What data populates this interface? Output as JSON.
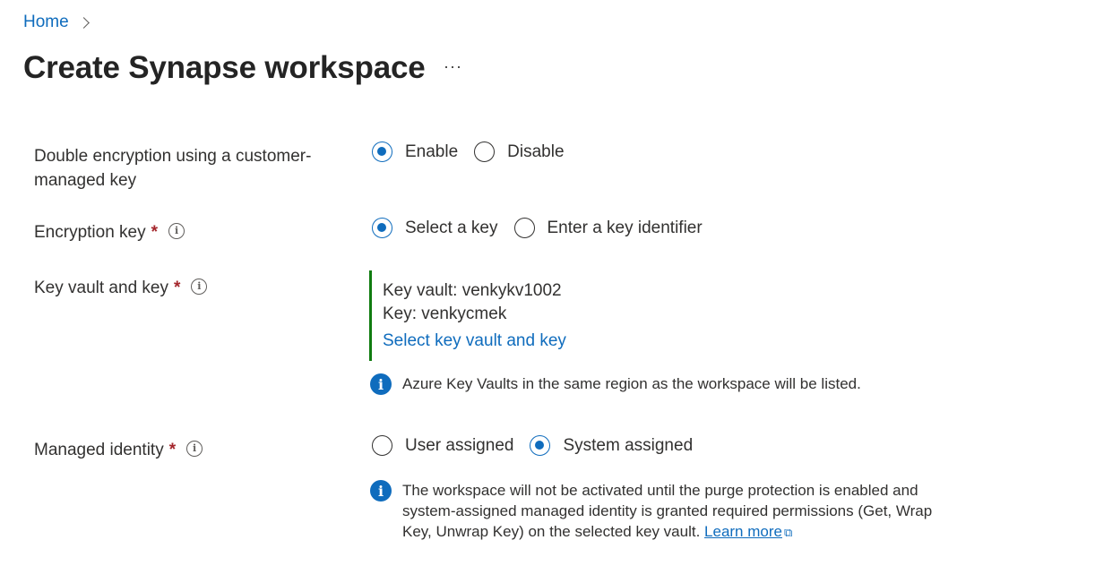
{
  "breadcrumb": {
    "home": "Home"
  },
  "page": {
    "title": "Create Synapse workspace",
    "more": "···"
  },
  "double_encryption": {
    "label_line1": "Double encryption using a customer-",
    "label_line2": "managed key",
    "options": [
      "Enable",
      "Disable"
    ],
    "selected": "Enable"
  },
  "encryption_key": {
    "label": "Encryption key",
    "required": "*",
    "options": [
      "Select a key",
      "Enter a key identifier"
    ],
    "selected": "Select a key"
  },
  "key_vault": {
    "label": "Key vault and key",
    "required": "*",
    "vault_line": "Key vault: venkykv1002",
    "key_line": "Key: venkycmek",
    "select_link": "Select key vault and key",
    "note": "Azure Key Vaults in the same region as the workspace will be listed."
  },
  "managed_identity": {
    "label": "Managed identity",
    "required": "*",
    "options": [
      "User assigned",
      "System assigned"
    ],
    "selected": "System assigned",
    "note_line1": "The workspace will not be activated until the purge protection is enabled and",
    "note_line2": "system-assigned managed identity is granted required permissions (Get, Wrap",
    "note_line3": "Key, Unwrap Key) on the selected key vault.",
    "learn_more": "Learn more"
  },
  "icons": {
    "info": "i",
    "external_link": "⧉"
  },
  "colors": {
    "accent": "#0f6cbd",
    "required": "#a4262c",
    "success_bar": "#107c10"
  }
}
